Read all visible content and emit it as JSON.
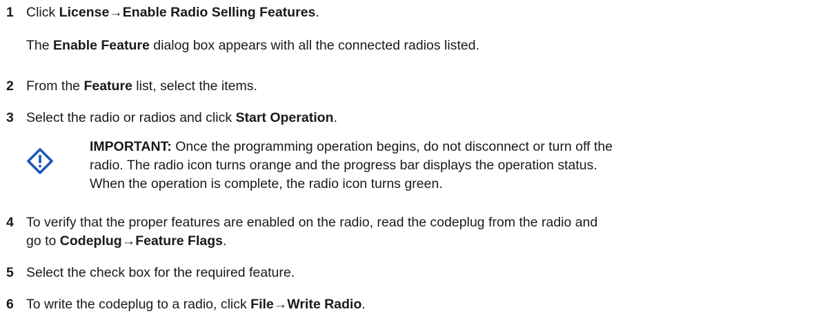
{
  "steps": [
    {
      "number": "1",
      "prefix": "Click ",
      "menu": "License",
      "arrow": "→",
      "item": "Enable Radio Selling Features",
      "suffix": ".",
      "result_prefix": "The ",
      "result_bold": "Enable Feature",
      "result_suffix": " dialog box appears with all the connected radios listed."
    },
    {
      "number": "2",
      "prefix": "From the ",
      "bold": "Feature",
      "suffix": " list, select the items."
    },
    {
      "number": "3",
      "prefix": "Select the radio or radios and click ",
      "bold": "Start Operation",
      "suffix": "."
    },
    {
      "number": "4",
      "line1": "To verify that the proper features are enabled on the radio, read the codeplug from the radio and",
      "line2_prefix": "go to ",
      "menu": "Codeplug",
      "arrow": "→",
      "item": "Feature Flags",
      "suffix": "."
    },
    {
      "number": "5",
      "text": "Select the check box for the required feature."
    },
    {
      "number": "6",
      "prefix": "To write the codeplug to a radio, click ",
      "menu": "File",
      "arrow": "→",
      "item": "Write Radio",
      "suffix": "."
    }
  ],
  "important_note": {
    "icon": "important-icon",
    "icon_color": "#1a56b4",
    "label": "IMPORTANT:",
    "line1": " Once the programming operation begins, do not disconnect or turn off the",
    "line2": "radio. The radio icon turns orange and the progress bar displays the operation status.",
    "line3": "When the operation is complete, the radio icon turns green."
  }
}
